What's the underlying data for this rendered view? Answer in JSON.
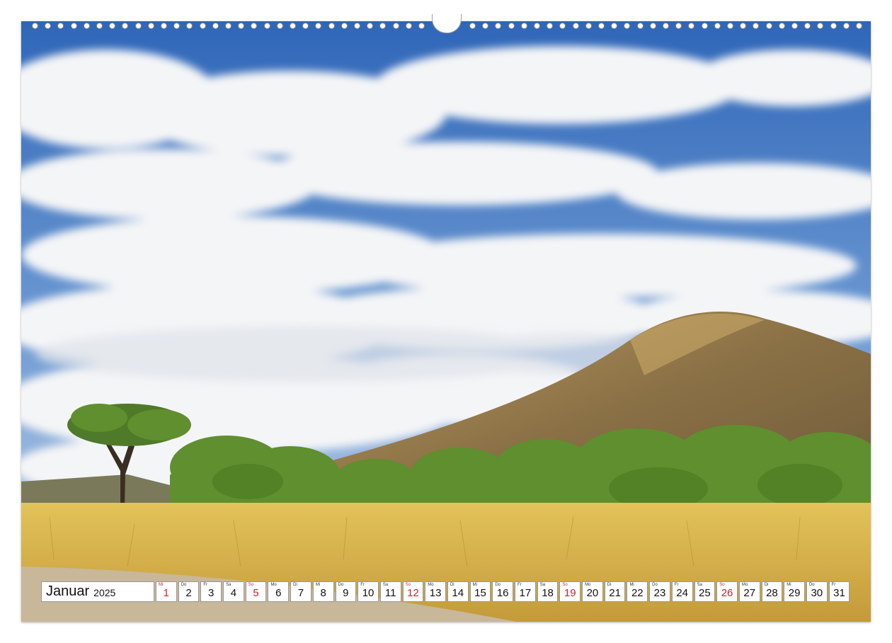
{
  "calendar": {
    "month": "Januar",
    "year": "2025",
    "days": [
      {
        "n": "1",
        "wd": "Mi",
        "kind": "holiday"
      },
      {
        "n": "2",
        "wd": "Do",
        "kind": "normal"
      },
      {
        "n": "3",
        "wd": "Fr",
        "kind": "normal"
      },
      {
        "n": "4",
        "wd": "Sa",
        "kind": "normal"
      },
      {
        "n": "5",
        "wd": "So",
        "kind": "sunday"
      },
      {
        "n": "6",
        "wd": "Mo",
        "kind": "normal"
      },
      {
        "n": "7",
        "wd": "Di",
        "kind": "normal"
      },
      {
        "n": "8",
        "wd": "Mi",
        "kind": "normal"
      },
      {
        "n": "9",
        "wd": "Do",
        "kind": "normal"
      },
      {
        "n": "10",
        "wd": "Fr",
        "kind": "normal"
      },
      {
        "n": "11",
        "wd": "Sa",
        "kind": "normal"
      },
      {
        "n": "12",
        "wd": "So",
        "kind": "sunday"
      },
      {
        "n": "13",
        "wd": "Mo",
        "kind": "normal"
      },
      {
        "n": "14",
        "wd": "Di",
        "kind": "normal"
      },
      {
        "n": "15",
        "wd": "Mi",
        "kind": "normal"
      },
      {
        "n": "16",
        "wd": "Do",
        "kind": "normal"
      },
      {
        "n": "17",
        "wd": "Fr",
        "kind": "normal"
      },
      {
        "n": "18",
        "wd": "Sa",
        "kind": "normal"
      },
      {
        "n": "19",
        "wd": "So",
        "kind": "sunday"
      },
      {
        "n": "20",
        "wd": "Mo",
        "kind": "normal"
      },
      {
        "n": "21",
        "wd": "Di",
        "kind": "normal"
      },
      {
        "n": "22",
        "wd": "Mi",
        "kind": "normal"
      },
      {
        "n": "23",
        "wd": "Do",
        "kind": "normal"
      },
      {
        "n": "24",
        "wd": "Fr",
        "kind": "normal"
      },
      {
        "n": "25",
        "wd": "Sa",
        "kind": "normal"
      },
      {
        "n": "26",
        "wd": "So",
        "kind": "sunday"
      },
      {
        "n": "27",
        "wd": "Mo",
        "kind": "normal"
      },
      {
        "n": "28",
        "wd": "Di",
        "kind": "normal"
      },
      {
        "n": "29",
        "wd": "Mi",
        "kind": "normal"
      },
      {
        "n": "30",
        "wd": "Do",
        "kind": "normal"
      },
      {
        "n": "31",
        "wd": "Fr",
        "kind": "normal"
      }
    ]
  },
  "colors": {
    "sky": "#4f82c8",
    "cloud": "#f2f3f5",
    "grass": "#d9b64a",
    "mountain": "#9a7a4c",
    "trees": "#5f8f2e",
    "road": "#c9b79a",
    "sunday": "#d2202f"
  }
}
